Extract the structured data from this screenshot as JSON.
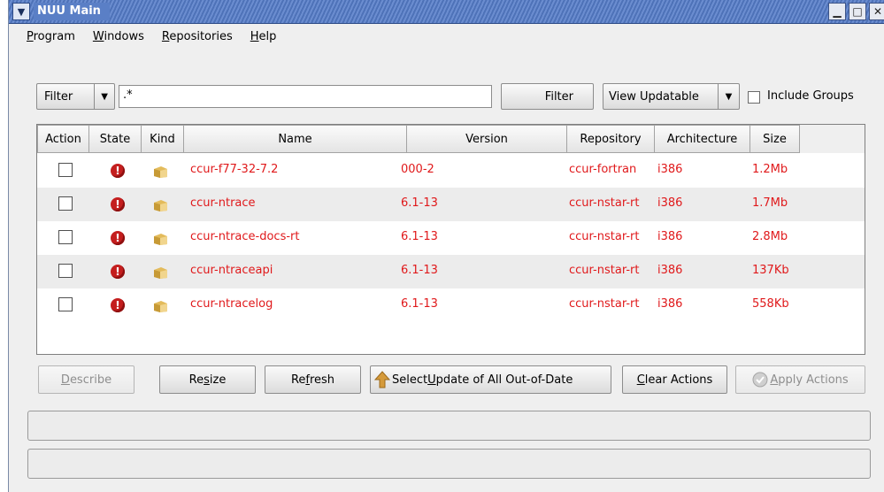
{
  "window": {
    "title": "NUU Main"
  },
  "menubar": [
    {
      "pre": "",
      "key": "P",
      "post": "rogram"
    },
    {
      "pre": "",
      "key": "W",
      "post": "indows"
    },
    {
      "pre": "",
      "key": "R",
      "post": "epositories"
    },
    {
      "pre": "",
      "key": "H",
      "post": "elp"
    }
  ],
  "toolbar": {
    "filter_type": "Filter",
    "filter_value": ".*",
    "filter_button": "Filter",
    "view_select": "View Updatable",
    "include_groups": "Include Groups",
    "include_groups_checked": false
  },
  "table": {
    "columns": [
      "Action",
      "State",
      "Kind",
      "Name",
      "Version",
      "Repository",
      "Architecture",
      "Size"
    ],
    "rows": [
      {
        "name": "ccur-f77-32-7.2",
        "version": "000-2",
        "repository": "ccur-fortran",
        "arch": "i386",
        "size": "1.2Mb"
      },
      {
        "name": "ccur-ntrace",
        "version": "6.1-13",
        "repository": "ccur-nstar-rt",
        "arch": "i386",
        "size": "1.7Mb"
      },
      {
        "name": "ccur-ntrace-docs-rt",
        "version": "6.1-13",
        "repository": "ccur-nstar-rt",
        "arch": "i386",
        "size": "2.8Mb"
      },
      {
        "name": "ccur-ntraceapi",
        "version": "6.1-13",
        "repository": "ccur-nstar-rt",
        "arch": "i386",
        "size": "137Kb"
      },
      {
        "name": "ccur-ntracelog",
        "version": "6.1-13",
        "repository": "ccur-nstar-rt",
        "arch": "i386",
        "size": "558Kb"
      }
    ],
    "row_text_color": "#e0191b"
  },
  "actions": {
    "describe": {
      "pre": "",
      "key": "D",
      "post": "escribe"
    },
    "resize": {
      "pre": "Re",
      "key": "s",
      "post": "ize"
    },
    "refresh": {
      "pre": "Re",
      "key": "f",
      "post": "resh"
    },
    "select_update": {
      "pre": "Select ",
      "key": "U",
      "post": "pdate of All Out-of-Date"
    },
    "clear_actions": {
      "pre": "",
      "key": "C",
      "post": "lear Actions"
    },
    "apply_actions": {
      "pre": "",
      "key": "A",
      "post": "pply Actions"
    }
  },
  "icons": {
    "window_menu": "chevron-down-icon",
    "minimize": "minimize-icon",
    "maximize": "maximize-icon",
    "close": "close-icon",
    "state": "error-icon",
    "kind": "package-icon",
    "select_update": "up-arrow-icon",
    "apply_actions": "check-circle-icon"
  }
}
